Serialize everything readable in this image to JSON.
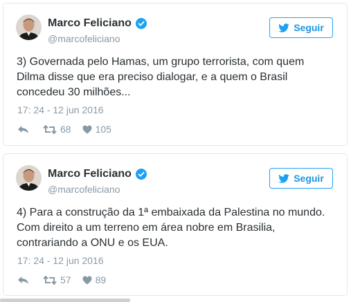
{
  "colors": {
    "name": "#292f33",
    "muted": "#8899a6",
    "accent": "#1da1f2",
    "border": "#e1e8ed"
  },
  "tweets": [
    {
      "author": "Marco Feliciano",
      "handle": "@marcofeliciano",
      "follow_label": "Seguir",
      "text": "3) Governada pelo Hamas, um grupo terrorista, com quem\nDilma disse que era preciso dialogar, e a quem o Brasil\nconcedeu 30 milhões...",
      "timestamp": "17: 24 - 12 jun 2016",
      "retweets": "68",
      "likes": "105"
    },
    {
      "author": "Marco Feliciano",
      "handle": "@marcofeliciano",
      "follow_label": "Seguir",
      "text": "4) Para a construção da 1ª embaixada da Palestina no mundo.\nCom direito a um terreno em área nobre em Brasilia,\ncontrariando a ONU e os EUA.",
      "timestamp": "17: 24 - 12 jun 2016",
      "retweets": "57",
      "likes": "89"
    }
  ],
  "icons": [
    "avatar",
    "verified-icon",
    "twitter-bird-icon",
    "reply-icon",
    "retweet-icon",
    "like-icon"
  ]
}
